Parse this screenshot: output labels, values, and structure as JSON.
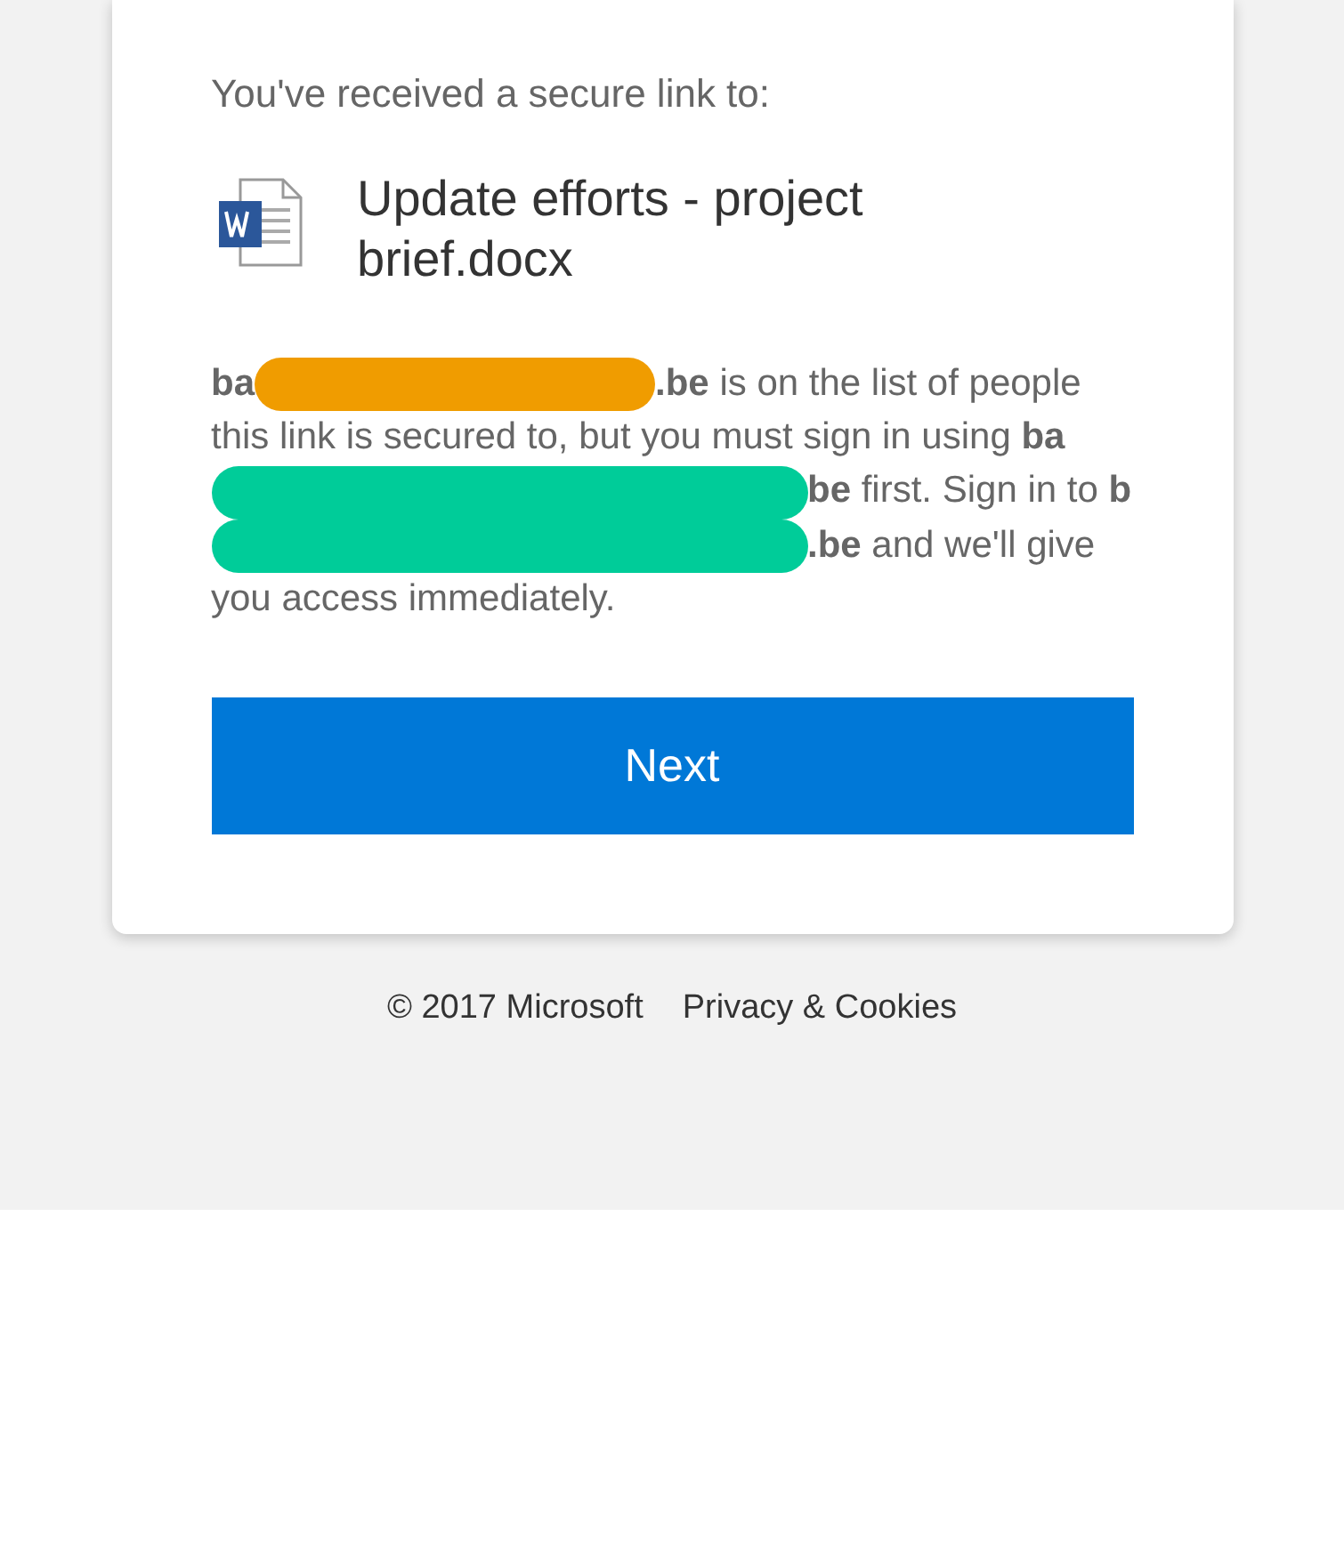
{
  "intro": "You've received a secure link to:",
  "file": {
    "name": "Update efforts - project brief.docx"
  },
  "message": [
    {
      "kind": "text",
      "text": "**ba**"
    },
    {
      "kind": "redaction",
      "color": "#f09c00"
    },
    {
      "kind": "text",
      "text": "**.be** is on the list of people this link is secured to, but you must sign in using **ba**"
    },
    {
      "kind": "redaction",
      "color": "#00cc99"
    },
    {
      "kind": "text",
      "text": "**be** first. Sign in to **b**"
    },
    {
      "kind": "redaction",
      "color": "#00cc99"
    },
    {
      "kind": "text",
      "text": "**.be** and we'll give you access immediately."
    }
  ],
  "button": "Next",
  "footer": {
    "copyright": "© 2017 Microsoft",
    "link": "Privacy & Cookies"
  }
}
